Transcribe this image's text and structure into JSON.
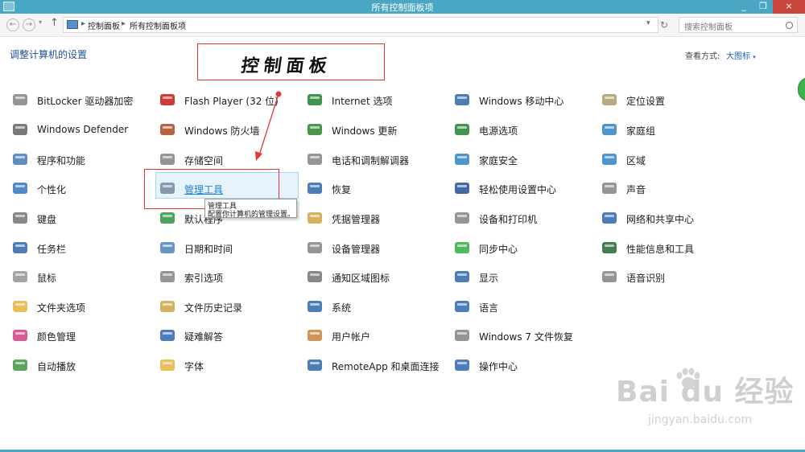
{
  "window": {
    "title": "所有控制面板项",
    "buttons": [
      "_",
      "❐",
      "×"
    ]
  },
  "address": {
    "crumbs": [
      "控制面板",
      "所有控制面板项"
    ],
    "separators": [
      "▸",
      "▸"
    ],
    "search_placeholder": "搜索控制面板"
  },
  "header": {
    "heading": "调整计算机的设置",
    "view_by": "查看方式:",
    "view_value": "大图标",
    "view_caret": "▾"
  },
  "annotation": {
    "label": "控制面板"
  },
  "items": [
    {
      "label": "BitLocker 驱动器加密",
      "icon": "bitlocker-key-icon",
      "color": "#8a8a8a"
    },
    {
      "label": "Windows Defender",
      "icon": "defender-wall-icon",
      "color": "#6b6b6b"
    },
    {
      "label": "程序和功能",
      "icon": "programs-icon",
      "color": "#4f7fb8"
    },
    {
      "label": "个性化",
      "icon": "personalization-icon",
      "color": "#3d7bc7"
    },
    {
      "label": "键盘",
      "icon": "keyboard-icon",
      "color": "#7a7a7a"
    },
    {
      "label": "任务栏",
      "icon": "taskbar-icon",
      "color": "#3a6fae"
    },
    {
      "label": "鼠标",
      "icon": "mouse-icon",
      "color": "#9a9a9a"
    },
    {
      "label": "文件夹选项",
      "icon": "folder-options-icon",
      "color": "#e6b84a"
    },
    {
      "label": "颜色管理",
      "icon": "color-management-icon",
      "color": "#d24a8a"
    },
    {
      "label": "自动播放",
      "icon": "autoplay-icon",
      "color": "#4a9a4a"
    },
    {
      "label": "Flash Player (32 位)",
      "icon": "flash-icon",
      "color": "#c8261c"
    },
    {
      "label": "Windows 防火墙",
      "icon": "firewall-icon",
      "color": "#a8552c"
    },
    {
      "label": "存储空间",
      "icon": "storage-icon",
      "color": "#8a8a8a"
    },
    {
      "label": "管理工具",
      "icon": "admin-tools-icon",
      "color": "#7a8fa5"
    },
    {
      "label": "默认程序",
      "icon": "default-programs-icon",
      "color": "#3a9a4a"
    },
    {
      "label": "日期和时间",
      "icon": "date-time-icon",
      "color": "#5a8ac0"
    },
    {
      "label": "索引选项",
      "icon": "indexing-icon",
      "color": "#8a8a8a"
    },
    {
      "label": "文件历史记录",
      "icon": "file-history-icon",
      "color": "#d4a84a"
    },
    {
      "label": "疑难解答",
      "icon": "troubleshooting-icon",
      "color": "#3a6fae"
    },
    {
      "label": "字体",
      "icon": "fonts-icon",
      "color": "#e6b84a"
    },
    {
      "label": "Internet 选项",
      "icon": "internet-options-icon",
      "color": "#2e8a3e"
    },
    {
      "label": "Windows 更新",
      "icon": "windows-update-icon",
      "color": "#3a8a3a"
    },
    {
      "label": "电话和调制解调器",
      "icon": "phone-modem-icon",
      "color": "#8a8a8a"
    },
    {
      "label": "恢复",
      "icon": "recovery-icon",
      "color": "#3a6fae"
    },
    {
      "label": "凭据管理器",
      "icon": "credential-icon",
      "color": "#d4a84a"
    },
    {
      "label": "设备管理器",
      "icon": "device-manager-icon",
      "color": "#8a8a8a"
    },
    {
      "label": "通知区域图标",
      "icon": "notification-area-icon",
      "color": "#7a7a7a"
    },
    {
      "label": "系统",
      "icon": "system-icon",
      "color": "#3a6fae"
    },
    {
      "label": "用户帐户",
      "icon": "user-accounts-icon",
      "color": "#c88a4a"
    },
    {
      "label": "RemoteApp 和桌面连接",
      "icon": "remoteapp-icon",
      "color": "#3a6fae"
    },
    {
      "label": "Windows 移动中心",
      "icon": "mobility-center-icon",
      "color": "#3a6fae"
    },
    {
      "label": "电源选项",
      "icon": "power-options-icon",
      "color": "#2e8a3e"
    },
    {
      "label": "家庭安全",
      "icon": "family-safety-icon",
      "color": "#3a8ac8"
    },
    {
      "label": "轻松使用设置中心",
      "icon": "ease-of-access-icon",
      "color": "#2a5a9a"
    },
    {
      "label": "设备和打印机",
      "icon": "devices-printers-icon",
      "color": "#8a8a8a"
    },
    {
      "label": "同步中心",
      "icon": "sync-center-icon",
      "color": "#3ab04a"
    },
    {
      "label": "显示",
      "icon": "display-icon",
      "color": "#3a6fae"
    },
    {
      "label": "语言",
      "icon": "language-icon",
      "color": "#3a6fae"
    },
    {
      "label": "Windows 7 文件恢复",
      "icon": "windows7-recovery-icon",
      "color": "#8a8a8a"
    },
    {
      "label": "操作中心",
      "icon": "action-center-icon",
      "color": "#3a6fae"
    },
    {
      "label": "定位设置",
      "icon": "location-settings-icon",
      "color": "#b0a070"
    },
    {
      "label": "家庭组",
      "icon": "homegroup-icon",
      "color": "#3a8ac8"
    },
    {
      "label": "区域",
      "icon": "region-icon",
      "color": "#3a8ac8"
    },
    {
      "label": "声音",
      "icon": "sound-icon",
      "color": "#8a8a8a"
    },
    {
      "label": "网络和共享中心",
      "icon": "network-sharing-icon",
      "color": "#3a6fae"
    },
    {
      "label": "性能信息和工具",
      "icon": "performance-icon",
      "color": "#2e6e3e"
    },
    {
      "label": "语音识别",
      "icon": "speech-recognition-icon",
      "color": "#8a8a8a"
    }
  ],
  "tooltip": {
    "title": "管理工具",
    "desc": "配置你计算机的管理设置。"
  },
  "watermark": {
    "brand": "Bai du 经验",
    "url": "jingyan.baidu.com"
  }
}
